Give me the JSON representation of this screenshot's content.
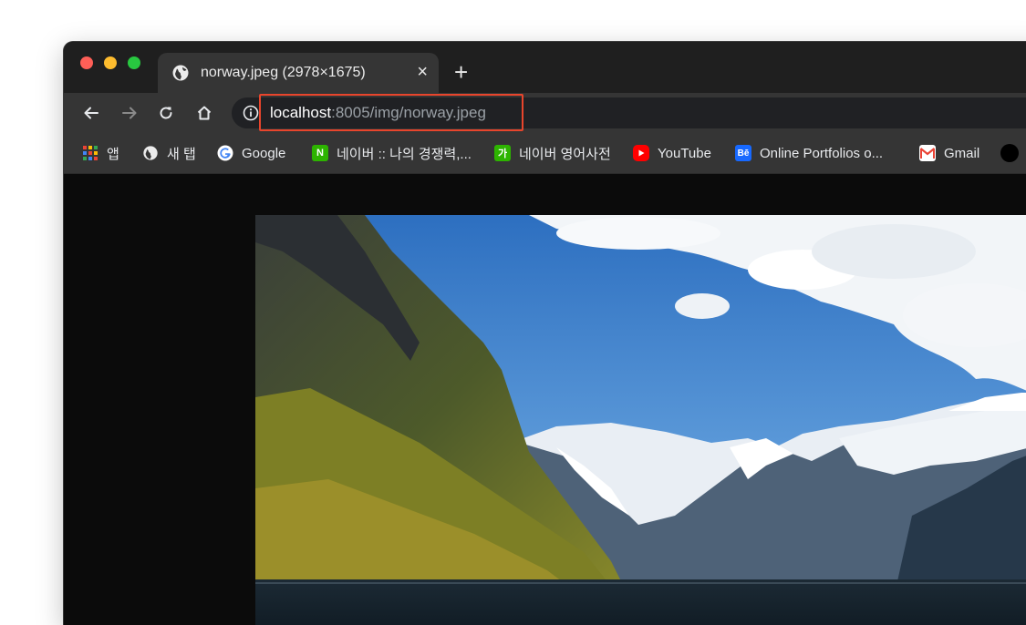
{
  "tab": {
    "title": "norway.jpeg (2978×1675)",
    "close": "×",
    "new_tab": "+"
  },
  "address": {
    "host": "localhost",
    "rest": ":8005/img/norway.jpeg"
  },
  "bookmarks": [
    {
      "label": "앱",
      "icon": "apps-grid-icon"
    },
    {
      "label": "새 탭",
      "icon": "globe-icon"
    },
    {
      "label": "Google",
      "icon": "google-icon"
    },
    {
      "label": "네이버 :: 나의 경쟁력,...",
      "icon": "naver-icon",
      "icon_text": "N"
    },
    {
      "label": "네이버 영어사전",
      "icon": "naver-dict-icon",
      "icon_text": "가"
    },
    {
      "label": "YouTube",
      "icon": "youtube-icon"
    },
    {
      "label": "Online Portfolios o...",
      "icon": "behance-icon",
      "icon_text": "Bē"
    },
    {
      "label": "Gmail",
      "icon": "gmail-icon"
    },
    {
      "label": "",
      "icon": "circle-icon"
    }
  ],
  "colors": {
    "highlight": "#e8452c",
    "chrome_dark": "#353535",
    "sky": "#4a86c8"
  }
}
